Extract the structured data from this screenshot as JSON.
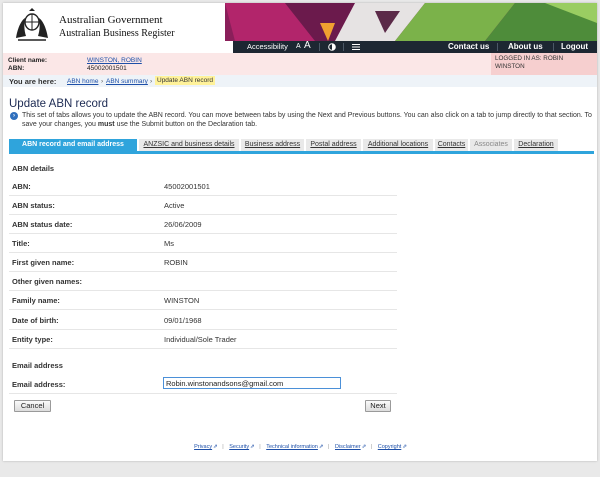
{
  "header": {
    "gov_name": "Australian Government",
    "register_name": "Australian Business Register",
    "toolbar": {
      "accessibility": "Accessibility",
      "text_small": "A",
      "text_large": "A",
      "contrast_icon": "contrast-icon",
      "menu_icon": "menu-icon"
    },
    "nav": {
      "contact": "Contact us",
      "about": "About us",
      "logout": "Logout"
    }
  },
  "client": {
    "name_label": "Client name:",
    "name_value": "WINSTON, ROBIN",
    "abn_label": "ABN:",
    "abn_value": "45002001501",
    "logged_in": "LOGGED IN AS: ROBIN WINSTON"
  },
  "breadcrumb": {
    "prefix": "You are here:",
    "items": [
      "ABN home",
      "ABN summary"
    ],
    "current": "Update ABN record"
  },
  "page": {
    "title": "Update ABN record",
    "intro_a": "This set of tabs allows you to update the ABN record. You can move between tabs by using the Next and Previous buttons. You can also click on a tab to jump directly to that section. To save your changes, you ",
    "intro_must": "must",
    "intro_b": " use the Submit button on the Declaration tab."
  },
  "tabs": [
    "ABN record and email address",
    "ANZSIC and business details",
    "Business address",
    "Postal address",
    "Additional locations",
    "Contacts",
    "Associates",
    "Declaration"
  ],
  "form": {
    "abn_section": "ABN details",
    "rows": [
      {
        "label": "ABN:",
        "value": "45002001501"
      },
      {
        "label": "ABN status:",
        "value": "Active"
      },
      {
        "label": "ABN status date:",
        "value": "26/06/2009"
      },
      {
        "label": "Title:",
        "value": "Ms"
      },
      {
        "label": "First given name:",
        "value": "ROBIN"
      },
      {
        "label": "Other given names:",
        "value": ""
      },
      {
        "label": "Family name:",
        "value": "WINSTON"
      },
      {
        "label": "Date of birth:",
        "value": "09/01/1968"
      },
      {
        "label": "Entity type:",
        "value": "Individual/Sole Trader"
      }
    ],
    "email_section": "Email address",
    "email_label": "Email address:",
    "email_value": "Robin.winstonandsons@gmail.com"
  },
  "buttons": {
    "cancel": "Cancel",
    "next": "Next"
  },
  "footer": {
    "links": [
      "Privacy",
      "Security",
      "Technical information",
      "Disclaimer",
      "Copyright"
    ]
  },
  "colors": {
    "tab_accent": "#2fa4dc",
    "toolbar_bg": "#1d2732",
    "client_strip": "#fbe7e7",
    "link": "#1d4fa8"
  }
}
